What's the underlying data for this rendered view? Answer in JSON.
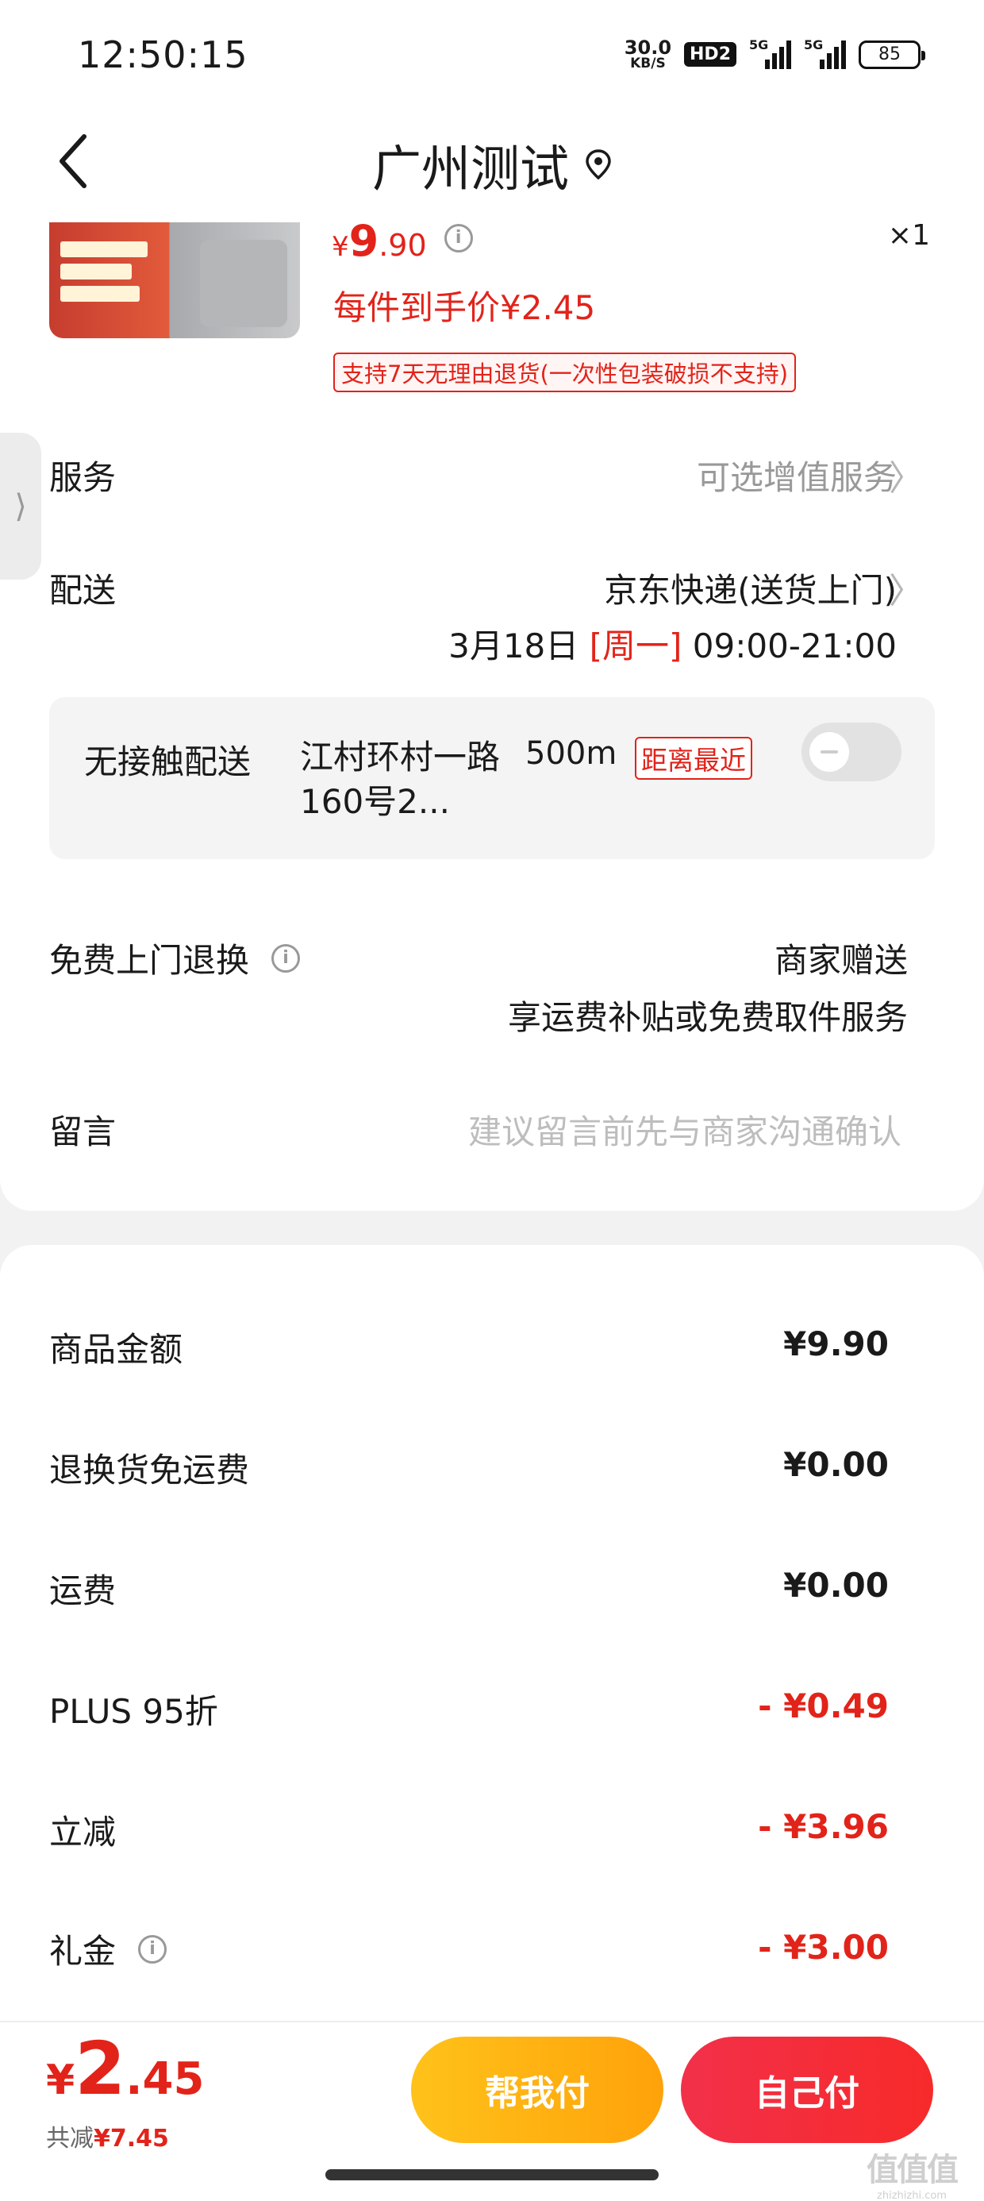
{
  "status_bar": {
    "time": "12:50:15",
    "net_speed_value": "30.0",
    "net_speed_unit": "KB/S",
    "hd_label": "HD2",
    "sim1_label": "5G",
    "sim2_label": "5G",
    "battery": "85"
  },
  "nav": {
    "title": "广州测试",
    "back_icon": "chevron-left-icon",
    "location_icon": "location-pin-icon"
  },
  "product": {
    "price_yen": "¥",
    "price_int": "9",
    "price_dec": ".90",
    "info_icon": "i",
    "quantity": "×1",
    "hand_price": "每件到手价¥2.45",
    "return_policy": "支持7天无理由退货(一次性包装破损不支持)"
  },
  "side_tab": {
    "icon": "⟩"
  },
  "rows": {
    "service_label": "服务",
    "service_value": "可选增值服务",
    "delivery_label": "配送",
    "delivery_method": "京东快递(送货上门)",
    "delivery_date": "3月18日",
    "delivery_weekday": "[周一]",
    "delivery_time": "09:00-21:00",
    "chevron": "〉"
  },
  "contactless": {
    "title": "无接触配送",
    "address": "江村环村一路160号2...",
    "distance": "500m",
    "nearest_tag": "距离最近",
    "enabled": false
  },
  "free_return": {
    "label": "免费上门退换",
    "info_icon": "i",
    "value_line1": "商家赠送",
    "value_line2": "享运费补贴或免费取件服务"
  },
  "message": {
    "label": "留言",
    "placeholder": "建议留言前先与商家沟通确认"
  },
  "summary": [
    {
      "label": "商品金额",
      "value": "¥9.90",
      "negative": false
    },
    {
      "label": "退换货免运费",
      "value": "¥0.00",
      "negative": false
    },
    {
      "label": "运费",
      "value": "¥0.00",
      "negative": false
    },
    {
      "label": "PLUS 95折",
      "value": "- ¥0.49",
      "negative": true
    },
    {
      "label": "立减",
      "value": "- ¥3.96",
      "negative": true
    },
    {
      "label": "礼金",
      "value": "- ¥3.00",
      "negative": true
    }
  ],
  "summary_info_icon": "i",
  "bottom": {
    "total_yen": "¥",
    "total_int": "2",
    "total_dec": ".45",
    "saved_label": "共减",
    "saved_amount": "¥7.45",
    "help_pay_button": "帮我付",
    "self_pay_button": "自己付"
  },
  "watermark": {
    "big": "值值值",
    "small": "zhizhizhi.com"
  },
  "colors": {
    "accent_red": "#e2231a",
    "help_button": "#ffb20f",
    "self_button": "#f52d3a"
  }
}
